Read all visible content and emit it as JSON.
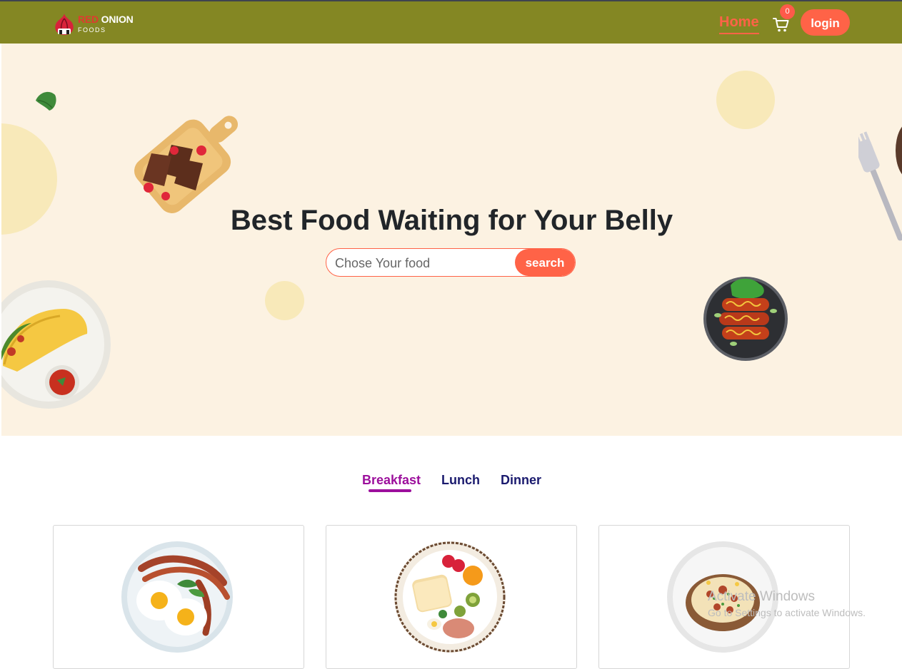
{
  "brand": {
    "name_red": "RED",
    "name_white": "ONION",
    "subtitle": "FOODS",
    "colors": {
      "primary": "#ff6347",
      "navbar": "#848723",
      "hero_bg": "#fcf2e2",
      "tab_active": "#9c0f9c",
      "tab_inactive": "#1a1a6e"
    }
  },
  "nav": {
    "home_label": "Home",
    "cart_icon": "cart-icon",
    "cart_count": "0",
    "login_label": "login"
  },
  "hero": {
    "title": "Best Food Waiting for Your Belly",
    "search": {
      "placeholder": "Chose Your food",
      "button_label": "search"
    }
  },
  "tabs": {
    "items": [
      {
        "label": "Breakfast",
        "active": true
      },
      {
        "label": "Lunch",
        "active": false
      },
      {
        "label": "Dinner",
        "active": false
      }
    ]
  },
  "cards": [
    {
      "image": "eggs-and-bacon-plate"
    },
    {
      "image": "toast-fruit-plate"
    },
    {
      "image": "baked-potato-bowl"
    }
  ],
  "watermark": {
    "title": "Activate Windows",
    "subtitle": "Go to Settings to activate Windows."
  }
}
